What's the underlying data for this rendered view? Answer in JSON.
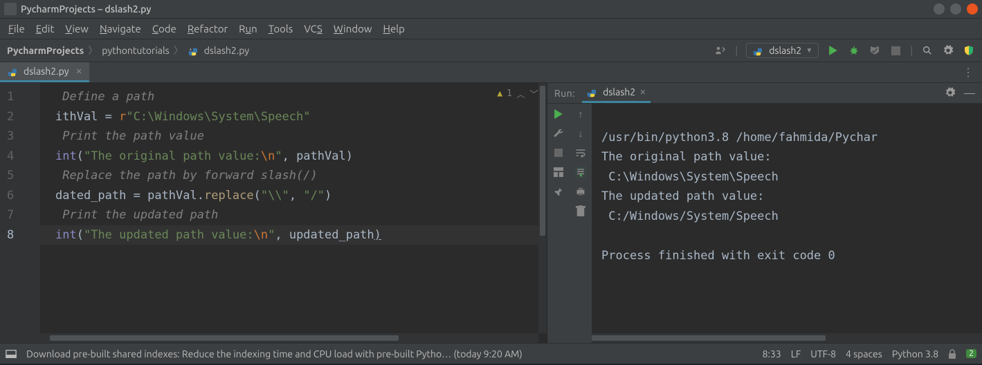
{
  "titlebar": {
    "text": "PycharmProjects – dslash2.py"
  },
  "menus": [
    "File",
    "Edit",
    "View",
    "Navigate",
    "Code",
    "Refactor",
    "Run",
    "Tools",
    "VCS",
    "Window",
    "Help"
  ],
  "breadcrumbs": {
    "root": "PycharmProjects",
    "folder": "pythontutorials",
    "file": "dslash2.py"
  },
  "run_config": {
    "name": "dslash2"
  },
  "editor_tab": {
    "file": "dslash2.py"
  },
  "inspection": {
    "warn_count": "1"
  },
  "gutter_lines": [
    "1",
    "2",
    "3",
    "4",
    "5",
    "6",
    "7",
    "8"
  ],
  "code": {
    "l1": " Define a path",
    "l2_ident": "ithVal",
    "l2_eq": " = ",
    "l2_r": "r",
    "l2_str": "\"C:\\Windows\\System\\Speech\"",
    "l3": " Print the path value",
    "l4_fn": "int",
    "l4_lp": "(",
    "l4_s1": "\"The original path value:",
    "l4_esc": "\\n",
    "l4_s1b": "\"",
    "l4_comma": ", ",
    "l4_arg": "pathVal",
    "l4_rp": ")",
    "l5": " Replace the path by forward slash(/)",
    "l6_lhs": "dated_path",
    "l6_eq": " = ",
    "l6_obj": "pathVal",
    "l6_dot": ".",
    "l6_meth": "replace",
    "l6_lp": "(",
    "l6_a1": "\"\\\\\"",
    "l6_comma": ", ",
    "l6_a2": "\"/\"",
    "l6_rp": ")",
    "l7": " Print the updated path",
    "l8_fn": "int",
    "l8_lp": "(",
    "l8_s1": "\"The updated path value:",
    "l8_esc": "\\n",
    "l8_s1b": "\"",
    "l8_comma": ", ",
    "l8_arg": "updated_path",
    "l8_rp": ")"
  },
  "run_panel": {
    "label": "Run:",
    "tab": "dslash2",
    "out1": "/usr/bin/python3.8 /home/fahmida/Pychar",
    "out2": "The original path value:",
    "out3": " C:\\Windows\\System\\Speech",
    "out4": "The updated path value:",
    "out5": " C:/Windows/System/Speech",
    "out7": "Process finished with exit code 0"
  },
  "status": {
    "message": "Download pre-built shared indexes: Reduce the indexing time and CPU load with pre-built Pytho… (today 9:20 AM)",
    "pos": "8:33",
    "le": "LF",
    "enc": "UTF-8",
    "indent": "4 spaces",
    "interp": "Python 3.8",
    "badge": "2"
  }
}
